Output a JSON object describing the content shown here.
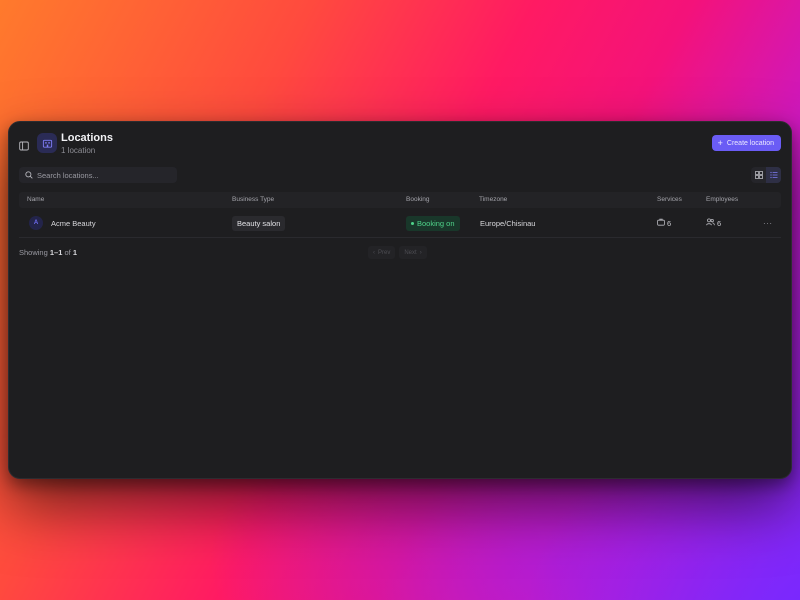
{
  "header": {
    "title": "Locations",
    "subtitle": "1 location",
    "create_label": "Create location"
  },
  "search": {
    "placeholder": "Search locations..."
  },
  "table": {
    "columns": [
      "Name",
      "Business Type",
      "Booking",
      "Timezone",
      "Services",
      "Employees"
    ],
    "rows": [
      {
        "avatar": "A",
        "name": "Acme Beauty",
        "business_type": "Beauty salon",
        "booking": "Booking on",
        "timezone": "Europe/Chisinau",
        "services": "6",
        "employees": "6",
        "more": "···"
      }
    ]
  },
  "pagination": {
    "showing_prefix": "Showing",
    "range": "1–1",
    "of_label": "of",
    "total": "1",
    "prev_label": "Prev",
    "next_label": "Next"
  },
  "icons": {
    "sidebar_toggle": "sidebar-panel-icon",
    "location": "building-icon",
    "search": "search-icon",
    "grid_view": "grid-icon",
    "list_view": "list-icon",
    "services": "briefcase-icon",
    "employees": "users-icon"
  },
  "colors": {
    "accent": "#6a5cf5",
    "booking_on": "#4fd38a",
    "window_bg": "#1e1e20"
  }
}
